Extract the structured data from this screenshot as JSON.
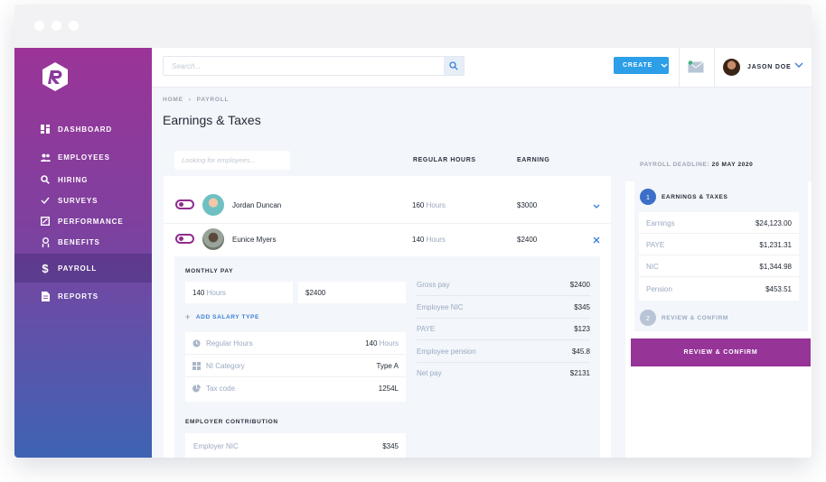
{
  "sidebar": {
    "items": [
      {
        "label": "DASHBOARD",
        "icon": "dashboard-icon"
      },
      {
        "label": "EMPLOYEES",
        "icon": "users-icon"
      },
      {
        "label": "HIRING",
        "icon": "search-icon"
      },
      {
        "label": "SURVEYS",
        "icon": "check-icon"
      },
      {
        "label": "PERFORMANCE",
        "icon": "chart-icon"
      },
      {
        "label": "BENEFITS",
        "icon": "benefits-icon"
      },
      {
        "label": "PAYROLL",
        "icon": "dollar-icon"
      },
      {
        "label": "REPORTS",
        "icon": "document-icon"
      }
    ],
    "active": "PAYROLL"
  },
  "topbar": {
    "search_placeholder": "Search...",
    "create_label": "CREATE",
    "user_name": "JASON DOE"
  },
  "breadcrumb": {
    "home": "HOME",
    "current": "PAYROLL"
  },
  "page_title": "Earnings & Taxes",
  "table": {
    "search_placeholder": "Looking for employees...",
    "col_hours": "REGULAR HOURS",
    "col_earning": "EARNING",
    "rows": [
      {
        "name": "Jordan Duncan",
        "hours": "160",
        "hours_unit": "Hours",
        "earning": "$3000"
      },
      {
        "name": "Eunice Myers",
        "hours": "140",
        "hours_unit": "Hours",
        "earning": "$2400"
      }
    ]
  },
  "detail": {
    "monthly_pay_title": "MONTHLY PAY",
    "hours_value": "140",
    "hours_unit": "Hours",
    "pay_value": "$2400",
    "add_salary_label": "ADD SALARY TYPE",
    "info": [
      {
        "label": "Regular Hours",
        "value": "140",
        "unit": "Hours"
      },
      {
        "label": "NI Category",
        "value": "Type A",
        "unit": ""
      },
      {
        "label": "Tax code",
        "value": "1254L",
        "unit": ""
      }
    ],
    "summary": [
      {
        "label": "Gross pay",
        "value": "$2400"
      },
      {
        "label": "Employee NIC",
        "value": "$345"
      },
      {
        "label": "PAYE",
        "value": "$123"
      },
      {
        "label": "Employee pension",
        "value": "$45.8"
      },
      {
        "label": "Net pay",
        "value": "$2131"
      }
    ],
    "employer_title": "EMPLOYER CONTRIBUTION",
    "employer_nic_label": "Employer NIC",
    "employer_nic_value": "$345"
  },
  "right_panel": {
    "deadline_label": "PAYROLL DEADLINE:",
    "deadline_date": "20 MAY 2020",
    "step1": {
      "num": "1",
      "label": "EARNINGS & TAXES"
    },
    "step2": {
      "num": "2",
      "label": "REVIEW & CONFIRM"
    },
    "earnings": [
      {
        "label": "Earnings",
        "value": "$24,123.00"
      },
      {
        "label": "PAYE",
        "value": "$1,231.31"
      },
      {
        "label": "NIC",
        "value": "$1,344.98"
      },
      {
        "label": "Pension",
        "value": "$453.51"
      }
    ],
    "button_label": "REVIEW & CONFIRM"
  },
  "colors": {
    "accent_purple": "#963498",
    "accent_blue": "#2d9ee8",
    "sidebar_top": "#9b3498",
    "sidebar_bottom": "#3e63b3"
  }
}
